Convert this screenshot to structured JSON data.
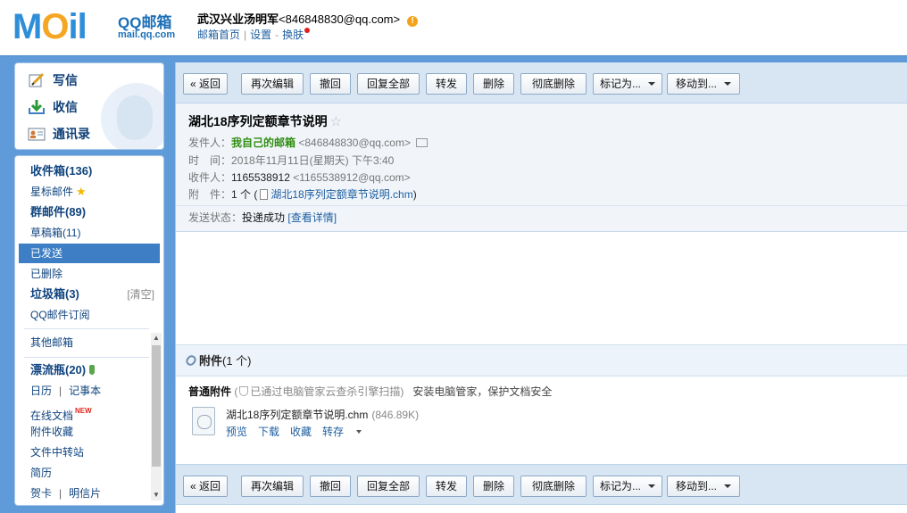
{
  "header": {
    "logo_text": "MOil",
    "logo_title": "QQ邮箱",
    "logo_url": "mail.qq.com",
    "user_name": "武汉兴业汤明军",
    "user_email": "<846848830@qq.com>",
    "links": [
      "邮箱首页",
      "设置",
      "换肤"
    ]
  },
  "sidebar": {
    "quick": [
      {
        "label": "写信",
        "icon": "pencil-icon"
      },
      {
        "label": "收信",
        "icon": "inbox-download-icon"
      },
      {
        "label": "通讯录",
        "icon": "contacts-card-icon"
      }
    ],
    "folders": {
      "inbox": "收件箱(136)",
      "starred": "星标邮件",
      "group": "群邮件(89)",
      "drafts": "草稿箱(11)",
      "sent": "已发送",
      "deleted": "已删除",
      "spam": "垃圾箱(3)",
      "spam_clear": "[清空]",
      "subscription": "QQ邮件订阅",
      "other": "其他邮箱",
      "bottle": "漂流瓶(20)",
      "calendar": "日历",
      "notes": "记事本",
      "docs": "在线文档",
      "docs_badge": "NEW",
      "attach_fav": "附件收藏",
      "transfer": "文件中转站",
      "resume": "简历",
      "card": "贺卡",
      "postcard": "明信片"
    }
  },
  "toolbar": {
    "back": "« 返回",
    "reedit": "再次编辑",
    "recall": "撤回",
    "reply_all": "回复全部",
    "forward": "转发",
    "delete": "删除",
    "delete_perm": "彻底删除",
    "mark_as": "标记为...",
    "move_to": "移动到..."
  },
  "mail": {
    "subject": "湖北18序列定额章节说明",
    "from_label": "发件人：",
    "from_name": "我自己的邮箱",
    "from_email": "<846848830@qq.com>",
    "time_label": "时　间：",
    "time_value": "2018年11月11日(星期天) 下午3:40",
    "to_label": "收件人：",
    "to_name": "1165538912",
    "to_email": "<1165538912@qq.com>",
    "attach_label": "附　件：",
    "attach_count": "1 个 (",
    "attach_file": "湖北18序列定额章节说明.chm",
    "attach_close": ")",
    "status_label": "发送状态：",
    "status_value": "投递成功",
    "status_link": "[查看详情]"
  },
  "attachments": {
    "title": "附件",
    "count": "(1 个)",
    "normal_label": "普通附件",
    "scan_note": "已通过电脑管家云查杀引擎扫描)",
    "scan_prefix": "(",
    "security_tip": "安装电脑管家，保护文档安全",
    "file_name": "湖北18序列定额章节说明.chm",
    "file_size": "(846.89K)",
    "actions": [
      "预览",
      "下载",
      "收藏",
      "转存"
    ]
  }
}
